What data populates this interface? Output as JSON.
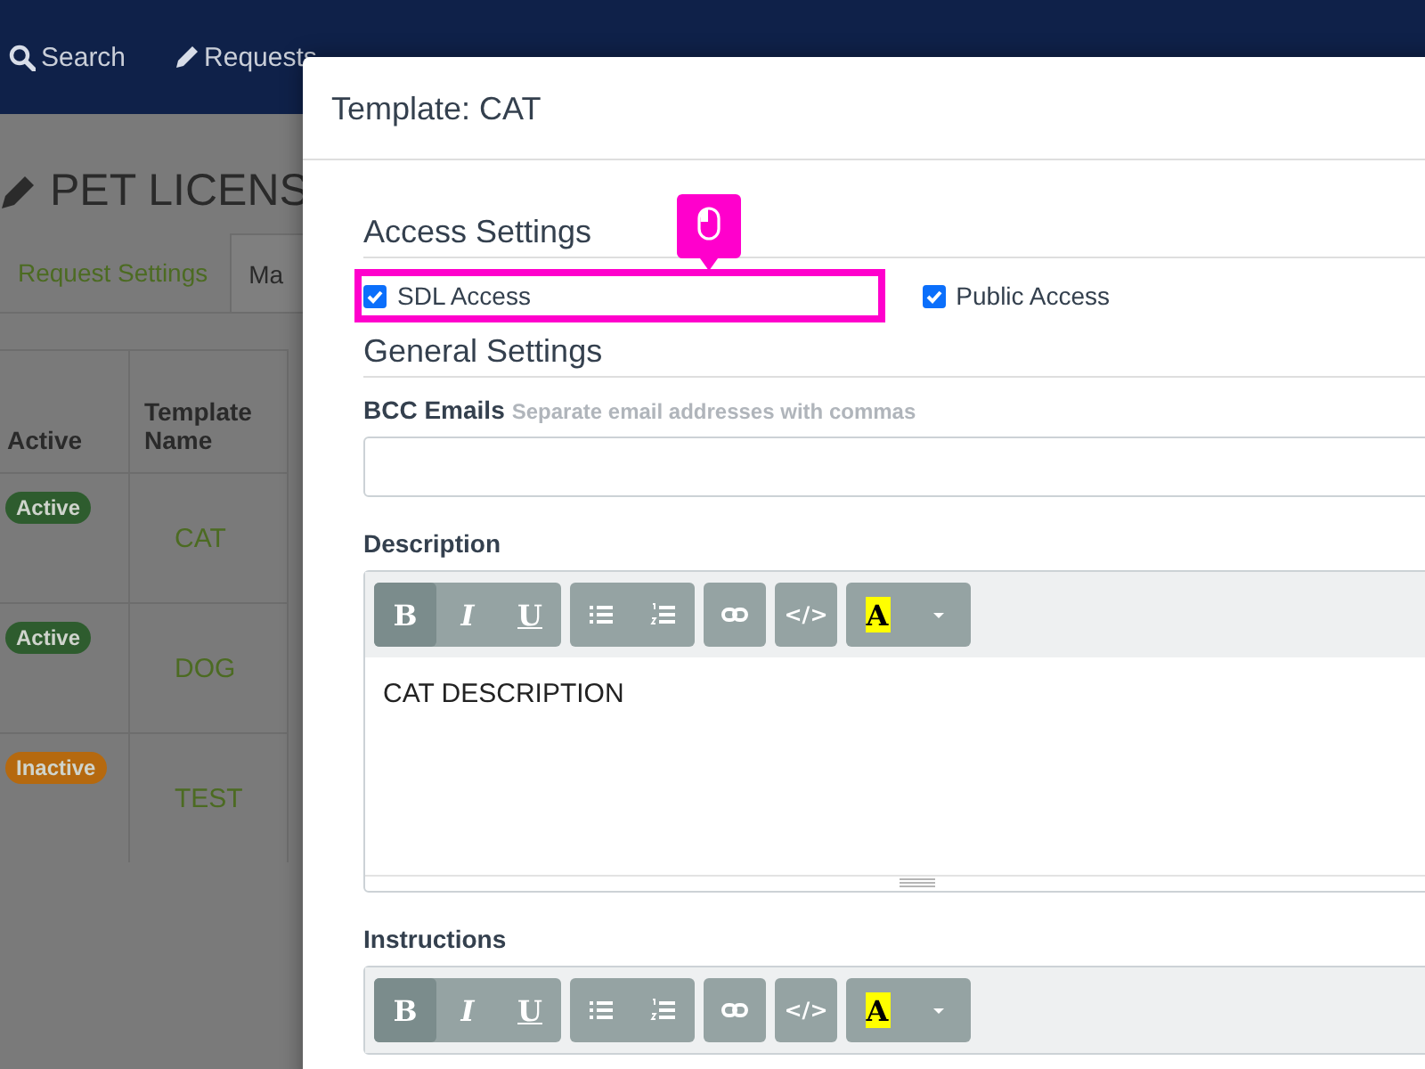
{
  "navbar": {
    "items": [
      {
        "label": "Search"
      },
      {
        "label": "Requests"
      }
    ]
  },
  "page": {
    "title": "PET LICENS",
    "tabs": [
      {
        "label": "Request Settings",
        "selected": false
      },
      {
        "label": "Ma",
        "selected": true
      }
    ],
    "table": {
      "columns": [
        "Active",
        "Template Name"
      ],
      "rows": [
        {
          "status": "Active",
          "color": "#2e5c2e",
          "name": "CAT"
        },
        {
          "status": "Active",
          "color": "#2e5c2e",
          "name": "DOG"
        },
        {
          "status": "Inactive",
          "color": "#b5690f",
          "name": "TEST"
        }
      ]
    }
  },
  "modal": {
    "title": "Template: CAT",
    "access_settings": {
      "heading": "Access Settings",
      "options": [
        {
          "label": "SDL Access",
          "checked": true,
          "highlighted": true
        },
        {
          "label": "Public Access",
          "checked": true,
          "highlighted": false
        }
      ]
    },
    "general_settings": {
      "heading": "General Settings",
      "bcc": {
        "label": "BCC Emails",
        "hint": "Separate email addresses with commas"
      },
      "editors": [
        {
          "label": "Description",
          "content": "CAT DESCRIPTION",
          "toolbar": [
            [
              {
                "kind": "bold",
                "label": "B",
                "selected": true
              },
              {
                "kind": "italic",
                "label": "I",
                "selected": false
              },
              {
                "kind": "underline",
                "label": "U",
                "selected": false
              }
            ],
            [
              {
                "kind": "bullet_list",
                "selected": false
              },
              {
                "kind": "numbered_list",
                "selected": false
              }
            ],
            [
              {
                "kind": "link",
                "selected": false
              }
            ],
            [
              {
                "kind": "code",
                "label": "</>",
                "selected": false
              }
            ],
            [
              {
                "kind": "color",
                "label": "A",
                "selected": false
              },
              {
                "kind": "dropdown",
                "selected": false
              }
            ]
          ]
        },
        {
          "label": "Instructions",
          "toolbar": [
            [
              {
                "kind": "bold",
                "label": "B",
                "selected": true
              },
              {
                "kind": "italic",
                "label": "I",
                "selected": false
              },
              {
                "kind": "underline",
                "label": "U",
                "selected": false
              }
            ],
            [
              {
                "kind": "bullet_list",
                "selected": false
              },
              {
                "kind": "numbered_list",
                "selected": false
              }
            ],
            [
              {
                "kind": "link",
                "selected": false
              }
            ],
            [
              {
                "kind": "code",
                "label": "</>",
                "selected": false
              }
            ],
            [
              {
                "kind": "color",
                "label": "A",
                "selected": false
              },
              {
                "kind": "dropdown",
                "selected": false
              }
            ]
          ]
        }
      ]
    }
  }
}
